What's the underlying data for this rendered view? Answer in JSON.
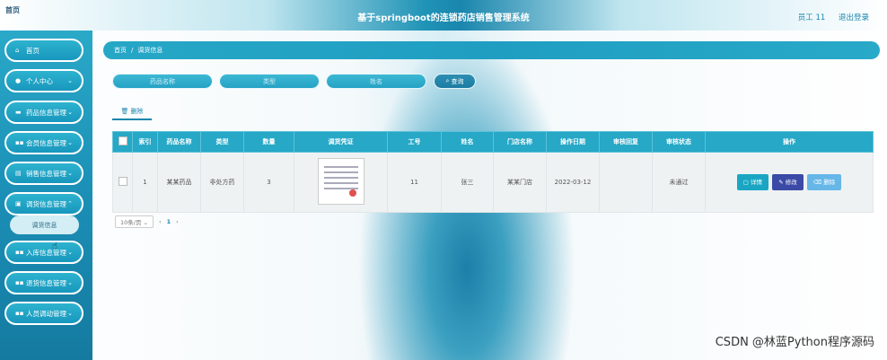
{
  "header": {
    "brand": "首页",
    "title": "基于springboot的连锁药店销售管理系统",
    "user_label": "员工 11",
    "logout_label": "退出登录"
  },
  "sidebar": {
    "items": [
      {
        "label": "首页",
        "icon": "home-icon"
      },
      {
        "label": "个人中心",
        "icon": "user-icon"
      },
      {
        "label": "药品信息管理",
        "icon": "pill-icon"
      },
      {
        "label": "会员信息管理",
        "icon": "grid-icon"
      },
      {
        "label": "销售信息管理",
        "icon": "cart-icon"
      },
      {
        "label": "调货信息管理",
        "icon": "lock-icon"
      },
      {
        "label": "入库信息管理",
        "icon": "grid-icon"
      },
      {
        "label": "退货信息管理",
        "icon": "grid-icon"
      },
      {
        "label": "人员调动管理",
        "icon": "grid-icon"
      }
    ],
    "submenu_active": "调货信息"
  },
  "breadcrumb": {
    "home": "首页",
    "sep": "/",
    "current": "调货信息"
  },
  "search": {
    "drug_name_placeholder": "药品名称",
    "type_placeholder": "类型",
    "name_placeholder": "姓名",
    "search_label": "查询"
  },
  "actions": {
    "delete_label": "删除"
  },
  "table": {
    "headers": [
      "",
      "索引",
      "药品名称",
      "类型",
      "数量",
      "调货凭证",
      "工号",
      "姓名",
      "门店名称",
      "操作日期",
      "审核回复",
      "审核状态",
      "操作"
    ],
    "rows": [
      {
        "index": "1",
        "drug_name": "某某药品",
        "type": "非处方药",
        "quantity": "3",
        "employee_no": "11",
        "name": "张三",
        "store": "某某门店",
        "date": "2022-03-12",
        "reply": "",
        "status": "未通过",
        "btn_detail": "详情",
        "btn_edit": "修改",
        "btn_delete": "删除"
      }
    ]
  },
  "pagination": {
    "page_size": "10条/页",
    "prev": "‹",
    "current": "1",
    "next": "›"
  },
  "watermark": "CSDN @林蓝Python程序源码",
  "colors": {
    "accent": "#26a8c6",
    "edit": "#3b4aa7",
    "delete": "#66b7e8"
  }
}
